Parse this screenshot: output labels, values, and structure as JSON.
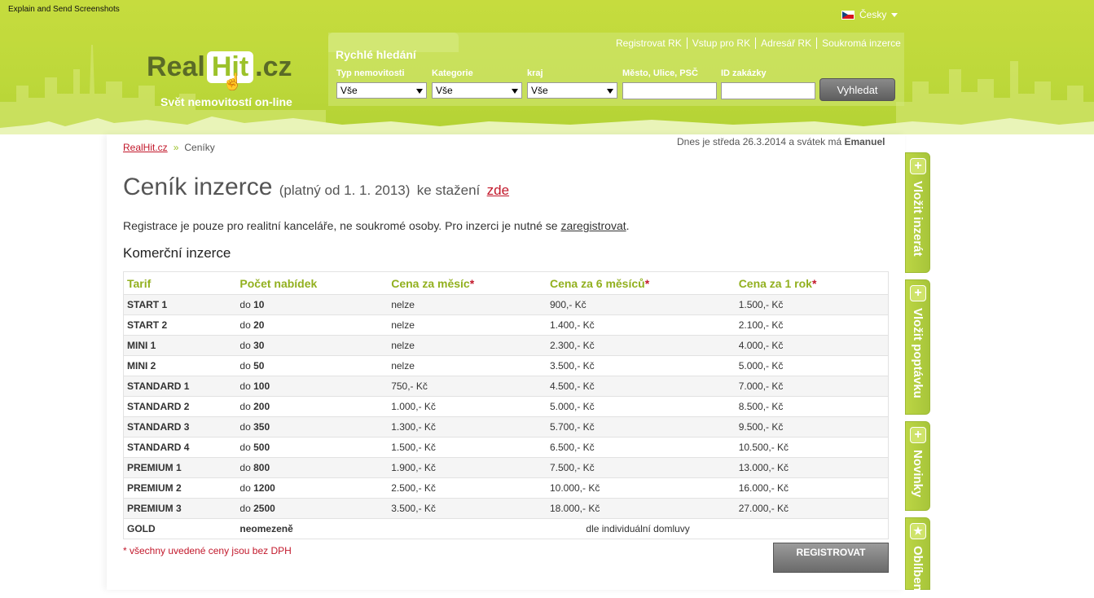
{
  "header": {
    "top_note": "Explain and Send Screenshots",
    "language": "Česky",
    "logo": {
      "part1": "Real",
      "part2": "Hit",
      "part3": ".cz"
    },
    "tagline": "Svět nemovitostí on-line",
    "quick_search_title": "Rychlé hledání",
    "top_links": [
      "Registrovat RK",
      "Vstup pro RK",
      "Adresář RK",
      "Soukromá inzerce"
    ],
    "fields": {
      "typ_label": "Typ nemovitosti",
      "typ_value": "Vše",
      "kategorie_label": "Kategorie",
      "kategorie_value": "Vše",
      "kraj_label": "kraj",
      "kraj_value": "Vše",
      "mesto_label": "Město, Ulice, PSČ",
      "id_label": "ID zakázky"
    },
    "search_button": "Vyhledat"
  },
  "breadcrumb": {
    "home": "RealHit.cz",
    "separator": "»",
    "current": "Ceníky"
  },
  "today": {
    "prefix": "Dnes je středa 26.3.2014 a svátek má ",
    "name": "Emanuel"
  },
  "title": {
    "main": "Ceník inzerce",
    "valid": "(platný od 1. 1. 2013)",
    "download": "ke stažení",
    "link": "zde"
  },
  "intro": {
    "text": "Registrace je pouze pro realitní kanceláře, ne soukromé osoby. Pro inzerci je nutné se ",
    "link": "zaregistrovat",
    "end": "."
  },
  "subtitle": "Komerční inzerce",
  "table": {
    "headers": [
      "Tarif",
      "Počet nabídek",
      "Cena za měsíc",
      "Cena za 6 měsíců",
      "Cena za 1 rok"
    ],
    "star": "*",
    "rows": [
      {
        "tarif": "START 1",
        "prefix": "do",
        "count": "10",
        "month": "nelze",
        "six": "900,- Kč",
        "year": "1.500,- Kč"
      },
      {
        "tarif": "START 2",
        "prefix": "do",
        "count": "20",
        "month": "nelze",
        "six": "1.400,- Kč",
        "year": "2.100,- Kč"
      },
      {
        "tarif": "MINI 1",
        "prefix": "do",
        "count": "30",
        "month": "nelze",
        "six": "2.300,- Kč",
        "year": "4.000,- Kč"
      },
      {
        "tarif": "MINI 2",
        "prefix": "do",
        "count": "50",
        "month": "nelze",
        "six": "3.500,- Kč",
        "year": "5.000,- Kč"
      },
      {
        "tarif": "STANDARD 1",
        "prefix": "do",
        "count": "100",
        "month": "750,- Kč",
        "six": "4.500,- Kč",
        "year": "7.000,- Kč"
      },
      {
        "tarif": "STANDARD 2",
        "prefix": "do",
        "count": "200",
        "month": "1.000,- Kč",
        "six": "5.000,- Kč",
        "year": "8.500,- Kč"
      },
      {
        "tarif": "STANDARD 3",
        "prefix": "do",
        "count": "350",
        "month": "1.300,- Kč",
        "six": "5.700,- Kč",
        "year": "9.500,- Kč"
      },
      {
        "tarif": "STANDARD 4",
        "prefix": "do",
        "count": "500",
        "month": "1.500,- Kč",
        "six": "6.500,- Kč",
        "year": "10.500,- Kč"
      },
      {
        "tarif": "PREMIUM 1",
        "prefix": "do",
        "count": "800",
        "month": "1.900,- Kč",
        "six": "7.500,- Kč",
        "year": "13.000,- Kč"
      },
      {
        "tarif": "PREMIUM 2",
        "prefix": "do",
        "count": "1200",
        "month": "2.500,- Kč",
        "six": "10.000,- Kč",
        "year": "16.000,- Kč"
      },
      {
        "tarif": "PREMIUM 3",
        "prefix": "do",
        "count": "2500",
        "month": "3.500,- Kč",
        "six": "18.000,- Kč",
        "year": "27.000,- Kč"
      }
    ],
    "gold": {
      "tarif": "GOLD",
      "count": "neomezeně",
      "price": "dle individuální domluvy"
    }
  },
  "note": "* všechny uvedené ceny jsou bez DPH",
  "register_button": "REGISTROVAT",
  "side_tabs": [
    {
      "label": "Vložit inzerát",
      "icon": "plus-icon",
      "symbol": "+"
    },
    {
      "label": "Vložit poptávku",
      "icon": "plus-icon",
      "symbol": "+"
    },
    {
      "label": "Novinky",
      "icon": "plus-icon",
      "symbol": "+"
    },
    {
      "label": "Oblíbené",
      "icon": "star-icon",
      "symbol": "★"
    }
  ]
}
